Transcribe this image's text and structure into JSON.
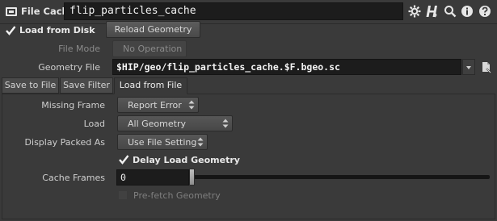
{
  "header": {
    "node_type": "File Cache",
    "node_name": "flip_particles_cache",
    "icons": [
      "node-type-icon",
      "gear-icon",
      "help-h-icon",
      "search-icon",
      "info-icon",
      "help-icon"
    ]
  },
  "top": {
    "load_from_disk_label": "Load from Disk",
    "load_from_disk_checked": true,
    "reload_label": "Reload Geometry",
    "file_mode_label": "File Mode",
    "file_mode_value": "No Operation",
    "geometry_file_label": "Geometry File",
    "geometry_file_value": "$HIP/geo/flip_particles_cache.$F.bgeo.sc"
  },
  "tabs": [
    {
      "label": "Save to File",
      "active": false
    },
    {
      "label": "Save Filter",
      "active": false
    },
    {
      "label": "Load from File",
      "active": true
    }
  ],
  "load_tab": {
    "missing_frame_label": "Missing Frame",
    "missing_frame_value": "Report Error",
    "load_label": "Load",
    "load_value": "All Geometry",
    "display_packed_label": "Display Packed As",
    "display_packed_value": "Use File Setting",
    "delay_load_label": "Delay Load Geometry",
    "delay_load_checked": true,
    "cache_frames_label": "Cache Frames",
    "cache_frames_value": "0",
    "prefetch_label": "Pre-fetch Geometry",
    "prefetch_checked": false
  },
  "colors": {
    "background": "#3a3a3a",
    "field_bg": "#1c1c1c",
    "button": "#535353"
  }
}
